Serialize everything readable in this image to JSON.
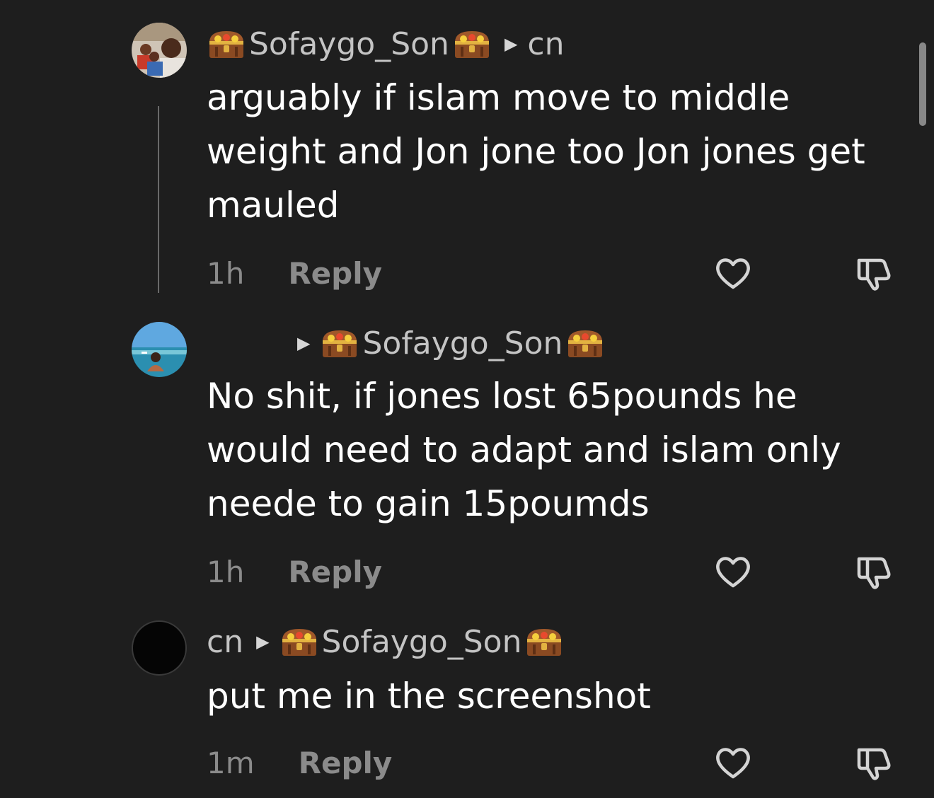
{
  "comments": [
    {
      "header_prefix": "",
      "username": "Sofaygo_Son",
      "reply_to": "cn",
      "text": "arguably if islam move to middle weight and Jon jone too Jon jones get mauled",
      "time": "1h",
      "reply_label": "Reply"
    },
    {
      "header_prefix": "",
      "username": "",
      "reply_to": "Sofaygo_Son",
      "text": "No shit, if jones lost 65pounds he would need to adapt and islam only neede to gain 15poumds",
      "time": "1h",
      "reply_label": "Reply"
    },
    {
      "header_prefix": "cn",
      "username": "",
      "reply_to": "Sofaygo_Son",
      "text": "put me in the screenshot",
      "time": "1m",
      "reply_label": "Reply"
    }
  ],
  "icons": {
    "badge": "treasure-chest-icon",
    "like": "heart-icon",
    "dislike": "thumbs-down-icon",
    "reply_arrow": "caret-right-icon"
  },
  "colors": {
    "background": "#1e1e1e",
    "text": "#ffffff",
    "muted": "#8b8b8b",
    "username": "#c4c4c4"
  }
}
